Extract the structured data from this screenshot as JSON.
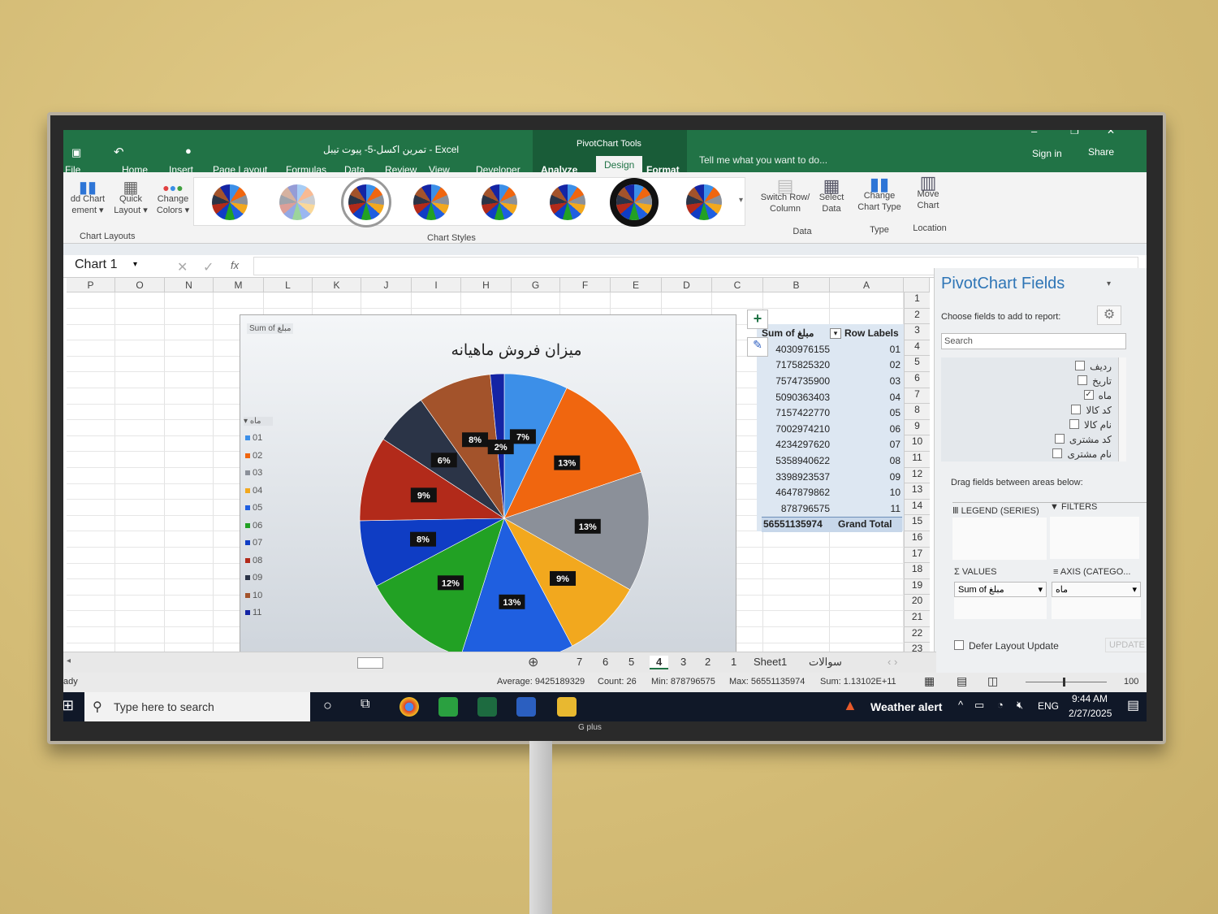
{
  "window": {
    "title": "تمرین اکسل-5- پیوت تیبل - Excel",
    "context_group": "PivotChart Tools",
    "sign_in": "Sign in",
    "share": "Share",
    "tell_me": "Tell me what you want to do..."
  },
  "tabs": [
    "File",
    "Home",
    "Insert",
    "Page Layout",
    "Formulas",
    "Data",
    "Review",
    "View",
    "Developer",
    "Analyze",
    "Design",
    "Format"
  ],
  "active_tab": "Design",
  "ribbon": {
    "add_chart_element": "dd Chart ement ▾",
    "quick_layout": "Quick Layout ▾",
    "change_colors": "Change Colors ▾",
    "chart_layouts": "Chart Layouts",
    "chart_styles": "Chart Styles",
    "switch_row_col": "Switch Row/ Column",
    "select_data": "Select Data",
    "data_group": "Data",
    "change_chart_type": "Change Chart Type",
    "type_group": "Type",
    "move_chart": "Move Chart",
    "location_group": "Location"
  },
  "formula_bar": {
    "name_box": "Chart 1",
    "fx": "fx",
    "value": ""
  },
  "columns": [
    "P",
    "O",
    "N",
    "M",
    "L",
    "K",
    "J",
    "I",
    "H",
    "G",
    "F",
    "E",
    "D",
    "C",
    "B",
    "A"
  ],
  "rows": [
    "1",
    "2",
    "3",
    "4",
    "5",
    "6",
    "7",
    "8",
    "9",
    "10",
    "11",
    "12",
    "13",
    "14",
    "15",
    "16",
    "17",
    "18",
    "19",
    "20",
    "21",
    "22",
    "23"
  ],
  "pivot": {
    "header_value": "Sum of مبلغ",
    "header_label": "Row Labels",
    "rows": [
      [
        "01",
        "4030976155"
      ],
      [
        "02",
        "7175825320"
      ],
      [
        "03",
        "7574735900"
      ],
      [
        "04",
        "5090363403"
      ],
      [
        "05",
        "7157422770"
      ],
      [
        "06",
        "7002974210"
      ],
      [
        "07",
        "4234297620"
      ],
      [
        "08",
        "5358940622"
      ],
      [
        "09",
        "3398923537"
      ],
      [
        "10",
        "4647879862"
      ],
      [
        "11",
        "878796575"
      ]
    ],
    "grand_total_label": "Grand Total",
    "grand_total": "56551135974"
  },
  "chart_data": {
    "type": "pie",
    "title": "میزان فروش ماهیانه",
    "value_field_button": "Sum of مبلغ",
    "legend_field_button": "ماه",
    "legend_position": "left",
    "categories": [
      "01",
      "02",
      "03",
      "04",
      "05",
      "06",
      "07",
      "08",
      "09",
      "10",
      "11"
    ],
    "values": [
      4030976155,
      7175825320,
      7574735900,
      5090363403,
      7157422770,
      7002974210,
      4234297620,
      5358940622,
      3398923537,
      4647879862,
      878796575
    ],
    "data_labels": [
      "7%",
      "13%",
      "13%",
      "9%",
      "13%",
      "12%",
      "8%",
      "9%",
      "6%",
      "8%",
      "2%"
    ],
    "colors": [
      "#3c8fe8",
      "#f0660f",
      "#8b9099",
      "#f2a81e",
      "#1f5fe0",
      "#22a124",
      "#0f3dc4",
      "#b22a1a",
      "#2b3447",
      "#a3532b",
      "#1424a4"
    ]
  },
  "fields_panel": {
    "title": "PivotChart Fields",
    "subtitle": "Choose fields to add to report:",
    "search_placeholder": "Search",
    "fields": [
      {
        "name": "ردیف",
        "checked": false
      },
      {
        "name": "تاریخ",
        "checked": false
      },
      {
        "name": "ماه",
        "checked": true
      },
      {
        "name": "کد کالا",
        "checked": false
      },
      {
        "name": "نام کالا",
        "checked": false
      },
      {
        "name": "کد مشتری",
        "checked": false
      },
      {
        "name": "نام مشتری",
        "checked": false
      }
    ],
    "drag_hint": "Drag fields between areas below:",
    "legend": "LEGEND (SERIES)",
    "filters": "FILTERS",
    "values": "VALUES",
    "axis": "AXIS (CATEGO...",
    "values_item": "Sum of مبلغ",
    "axis_item": "ماه",
    "defer": "Defer Layout Update",
    "update": "UPDATE"
  },
  "sheet_tabs": [
    "7",
    "6",
    "5",
    "4",
    "3",
    "2",
    "1",
    "Sheet1",
    "سوالات"
  ],
  "active_sheet": "4",
  "status": {
    "mode": "ady",
    "average": "Average: 9425189329",
    "count": "Count: 26",
    "min": "Min: 878796575",
    "max": "Max: 56551135974",
    "sum": "Sum: 1.13102E+11",
    "zoom": "100"
  },
  "taskbar": {
    "search_placeholder": "Type here to search",
    "weather": "Weather alert",
    "lang": "ENG",
    "time": "9:44 AM",
    "date": "2/27/2025"
  },
  "brand": "G plus"
}
